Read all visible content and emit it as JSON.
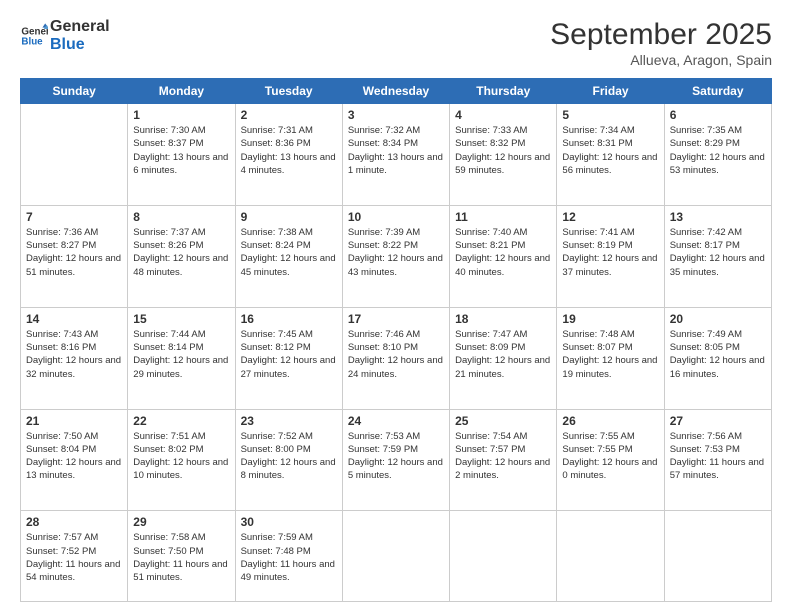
{
  "header": {
    "logo_line1": "General",
    "logo_line2": "Blue",
    "month": "September 2025",
    "location": "Allueva, Aragon, Spain"
  },
  "weekdays": [
    "Sunday",
    "Monday",
    "Tuesday",
    "Wednesday",
    "Thursday",
    "Friday",
    "Saturday"
  ],
  "weeks": [
    [
      {
        "day": null
      },
      {
        "day": "1",
        "sunrise": "7:30 AM",
        "sunset": "8:37 PM",
        "daylight": "13 hours and 6 minutes."
      },
      {
        "day": "2",
        "sunrise": "7:31 AM",
        "sunset": "8:36 PM",
        "daylight": "13 hours and 4 minutes."
      },
      {
        "day": "3",
        "sunrise": "7:32 AM",
        "sunset": "8:34 PM",
        "daylight": "13 hours and 1 minute."
      },
      {
        "day": "4",
        "sunrise": "7:33 AM",
        "sunset": "8:32 PM",
        "daylight": "12 hours and 59 minutes."
      },
      {
        "day": "5",
        "sunrise": "7:34 AM",
        "sunset": "8:31 PM",
        "daylight": "12 hours and 56 minutes."
      },
      {
        "day": "6",
        "sunrise": "7:35 AM",
        "sunset": "8:29 PM",
        "daylight": "12 hours and 53 minutes."
      }
    ],
    [
      {
        "day": "7",
        "sunrise": "7:36 AM",
        "sunset": "8:27 PM",
        "daylight": "12 hours and 51 minutes."
      },
      {
        "day": "8",
        "sunrise": "7:37 AM",
        "sunset": "8:26 PM",
        "daylight": "12 hours and 48 minutes."
      },
      {
        "day": "9",
        "sunrise": "7:38 AM",
        "sunset": "8:24 PM",
        "daylight": "12 hours and 45 minutes."
      },
      {
        "day": "10",
        "sunrise": "7:39 AM",
        "sunset": "8:22 PM",
        "daylight": "12 hours and 43 minutes."
      },
      {
        "day": "11",
        "sunrise": "7:40 AM",
        "sunset": "8:21 PM",
        "daylight": "12 hours and 40 minutes."
      },
      {
        "day": "12",
        "sunrise": "7:41 AM",
        "sunset": "8:19 PM",
        "daylight": "12 hours and 37 minutes."
      },
      {
        "day": "13",
        "sunrise": "7:42 AM",
        "sunset": "8:17 PM",
        "daylight": "12 hours and 35 minutes."
      }
    ],
    [
      {
        "day": "14",
        "sunrise": "7:43 AM",
        "sunset": "8:16 PM",
        "daylight": "12 hours and 32 minutes."
      },
      {
        "day": "15",
        "sunrise": "7:44 AM",
        "sunset": "8:14 PM",
        "daylight": "12 hours and 29 minutes."
      },
      {
        "day": "16",
        "sunrise": "7:45 AM",
        "sunset": "8:12 PM",
        "daylight": "12 hours and 27 minutes."
      },
      {
        "day": "17",
        "sunrise": "7:46 AM",
        "sunset": "8:10 PM",
        "daylight": "12 hours and 24 minutes."
      },
      {
        "day": "18",
        "sunrise": "7:47 AM",
        "sunset": "8:09 PM",
        "daylight": "12 hours and 21 minutes."
      },
      {
        "day": "19",
        "sunrise": "7:48 AM",
        "sunset": "8:07 PM",
        "daylight": "12 hours and 19 minutes."
      },
      {
        "day": "20",
        "sunrise": "7:49 AM",
        "sunset": "8:05 PM",
        "daylight": "12 hours and 16 minutes."
      }
    ],
    [
      {
        "day": "21",
        "sunrise": "7:50 AM",
        "sunset": "8:04 PM",
        "daylight": "12 hours and 13 minutes."
      },
      {
        "day": "22",
        "sunrise": "7:51 AM",
        "sunset": "8:02 PM",
        "daylight": "12 hours and 10 minutes."
      },
      {
        "day": "23",
        "sunrise": "7:52 AM",
        "sunset": "8:00 PM",
        "daylight": "12 hours and 8 minutes."
      },
      {
        "day": "24",
        "sunrise": "7:53 AM",
        "sunset": "7:59 PM",
        "daylight": "12 hours and 5 minutes."
      },
      {
        "day": "25",
        "sunrise": "7:54 AM",
        "sunset": "7:57 PM",
        "daylight": "12 hours and 2 minutes."
      },
      {
        "day": "26",
        "sunrise": "7:55 AM",
        "sunset": "7:55 PM",
        "daylight": "12 hours and 0 minutes."
      },
      {
        "day": "27",
        "sunrise": "7:56 AM",
        "sunset": "7:53 PM",
        "daylight": "11 hours and 57 minutes."
      }
    ],
    [
      {
        "day": "28",
        "sunrise": "7:57 AM",
        "sunset": "7:52 PM",
        "daylight": "11 hours and 54 minutes."
      },
      {
        "day": "29",
        "sunrise": "7:58 AM",
        "sunset": "7:50 PM",
        "daylight": "11 hours and 51 minutes."
      },
      {
        "day": "30",
        "sunrise": "7:59 AM",
        "sunset": "7:48 PM",
        "daylight": "11 hours and 49 minutes."
      },
      {
        "day": null
      },
      {
        "day": null
      },
      {
        "day": null
      },
      {
        "day": null
      }
    ]
  ]
}
